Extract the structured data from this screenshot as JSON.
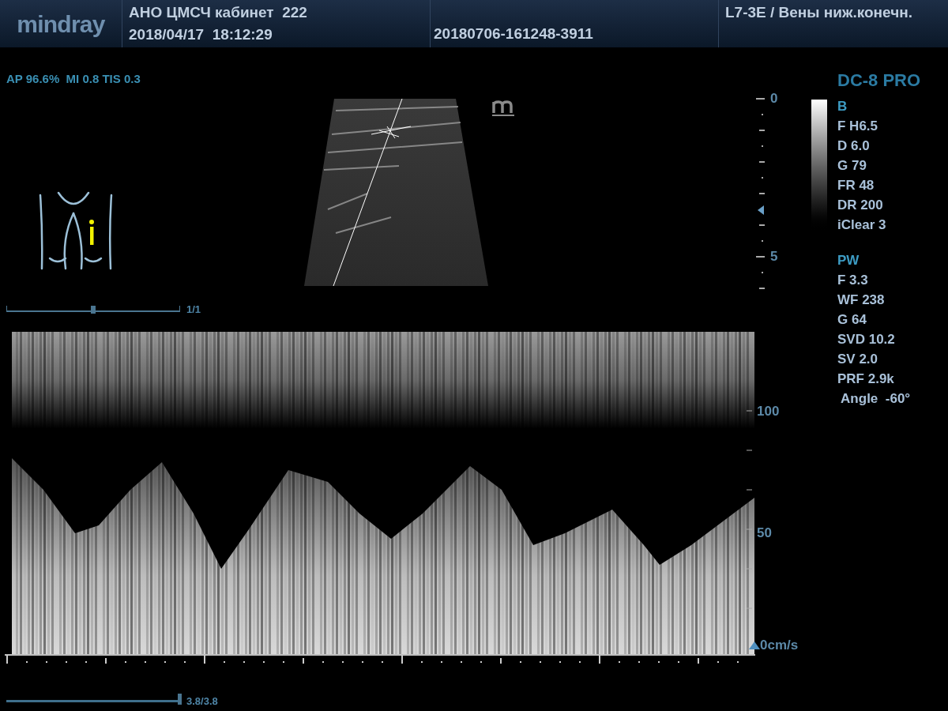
{
  "header": {
    "logo": "mindray",
    "facility": "АНО ЦМСЧ кабинет  222",
    "datetime": "2018/04/17  18:12:29",
    "exam_id": "20180706-161248-3911",
    "probe_preset": "L7-3E / Вены ниж.конечн."
  },
  "acoustic_output": "AP 96.6%  MI 0.8 TIS 0.3",
  "cine_scale": {
    "reading": "1/1",
    "level": 0.5
  },
  "depth_scale": {
    "labels": [
      "0",
      "5"
    ]
  },
  "device_model": "DC-8 PRO",
  "b_mode": {
    "title": "B",
    "params": [
      "F H6.5",
      "D 6.0",
      "G 79",
      "FR 48",
      "DR 200",
      "iClear 3"
    ]
  },
  "pw_mode": {
    "title": "PW",
    "params": [
      "F 3.3",
      "WF 238",
      "G 64",
      "SVD 10.2",
      "SV 2.0",
      "PRF 2.9k",
      " Angle  -60°"
    ]
  },
  "velocity_scale": {
    "labels": [
      "100",
      "50",
      "0cm/s"
    ]
  },
  "time_scale": {
    "reading": "3.8/3.8",
    "level": 1
  }
}
